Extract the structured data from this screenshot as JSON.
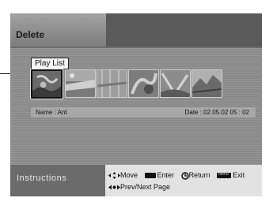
{
  "title": "Delete",
  "playlist_label": "Play List",
  "thumbnails": [
    {
      "selected": true
    },
    {
      "selected": false
    },
    {
      "selected": false
    },
    {
      "selected": false
    },
    {
      "selected": false
    },
    {
      "selected": false
    }
  ],
  "info": {
    "name": "Name : Ant",
    "date": "Date : 02.05.02  05 : 02"
  },
  "instructions": {
    "label": "Instructions",
    "move": "Move",
    "enter": "Enter",
    "return": "Return",
    "exit": "Exit",
    "page": "Prev/Next Page"
  }
}
